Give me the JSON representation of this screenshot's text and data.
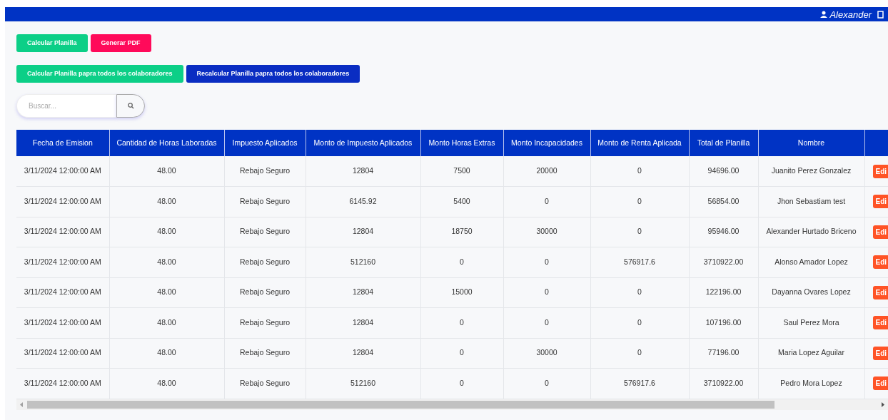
{
  "navbar": {
    "user_name": "Alexander"
  },
  "actions": [
    {
      "label": "Calcular Planilla",
      "kind": "success"
    },
    {
      "label": "Generar PDF",
      "kind": "danger"
    }
  ],
  "bulk_actions": [
    {
      "label": "Calcular Planilla papra todos los colaboradores",
      "kind": "success"
    },
    {
      "label": "Recalcular Planilla papra todos los colaboradores",
      "kind": "primary"
    }
  ],
  "search": {
    "placeholder": "Buscar..."
  },
  "table": {
    "columns": [
      "Fecha de Emision",
      "Cantidad de Horas Laboradas",
      "Impuesto Aplicados",
      "Monto de Impuesto Aplicados",
      "Monto Horas Extras",
      "Monto Incapacidades",
      "Monto de Renta Aplicada",
      "Total de Planilla",
      "Nombre"
    ],
    "rows": [
      {
        "cells": [
          "3/11/2024 12:00:00 AM",
          "48.00",
          "Rebajo Seguro",
          "12804",
          "7500",
          "20000",
          "0",
          "94696.00",
          "Juanito Perez Gonzalez"
        ],
        "action": "Edi"
      },
      {
        "cells": [
          "3/11/2024 12:00:00 AM",
          "48.00",
          "Rebajo Seguro",
          "6145.92",
          "5400",
          "0",
          "0",
          "56854.00",
          "Jhon Sebastiam test"
        ],
        "action": "Edi"
      },
      {
        "cells": [
          "3/11/2024 12:00:00 AM",
          "48.00",
          "Rebajo Seguro",
          "12804",
          "18750",
          "30000",
          "0",
          "95946.00",
          "Alexander Hurtado Briceno"
        ],
        "action": "Edi"
      },
      {
        "cells": [
          "3/11/2024 12:00:00 AM",
          "48.00",
          "Rebajo Seguro",
          "512160",
          "0",
          "0",
          "576917.6",
          "3710922.00",
          "Alonso Amador Lopez"
        ],
        "action": "Edi"
      },
      {
        "cells": [
          "3/11/2024 12:00:00 AM",
          "48.00",
          "Rebajo Seguro",
          "12804",
          "15000",
          "0",
          "0",
          "122196.00",
          "Dayanna Ovares Lopez"
        ],
        "action": "Edi"
      },
      {
        "cells": [
          "3/11/2024 12:00:00 AM",
          "48.00",
          "Rebajo Seguro",
          "12804",
          "0",
          "0",
          "0",
          "107196.00",
          "Saul Perez Mora"
        ],
        "action": "Edi"
      },
      {
        "cells": [
          "3/11/2024 12:00:00 AM",
          "48.00",
          "Rebajo Seguro",
          "12804",
          "0",
          "30000",
          "0",
          "77196.00",
          "Maria Lopez Aguilar"
        ],
        "action": "Edi"
      },
      {
        "cells": [
          "3/11/2024 12:00:00 AM",
          "48.00",
          "Rebajo Seguro",
          "512160",
          "0",
          "0",
          "576917.6",
          "3710922.00",
          "Pedro Mora Lopez"
        ],
        "action": "Edi"
      }
    ]
  }
}
